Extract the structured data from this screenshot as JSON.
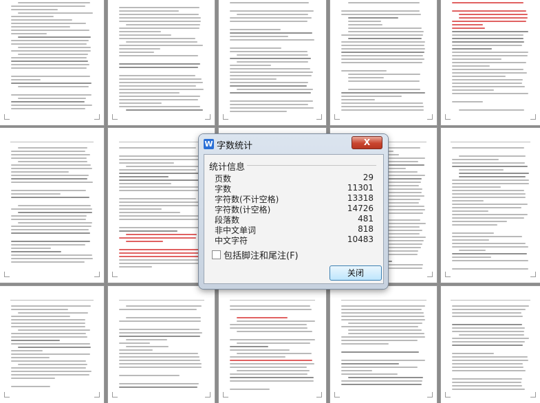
{
  "dialog": {
    "title": "字数统计",
    "app_icon": "wps-writer-icon",
    "close_glyph": "X",
    "group_label": "统计信息",
    "stats": [
      {
        "label": "页数",
        "value": "29"
      },
      {
        "label": "字数",
        "value": "11301"
      },
      {
        "label": "字符数(不计空格)",
        "value": "13318"
      },
      {
        "label": "字符数(计空格)",
        "value": "14726"
      },
      {
        "label": "段落数",
        "value": "481"
      },
      {
        "label": "非中文单词",
        "value": "818"
      },
      {
        "label": "中文字符",
        "value": "10483"
      }
    ],
    "checkbox_label": "包括脚注和尾注(F)",
    "checkbox_checked": false,
    "close_button": "关闭"
  },
  "colors": {
    "background": "#8c8c8c",
    "close_button_red": "#c9452f",
    "accent_blue": "#2a6fd6"
  }
}
